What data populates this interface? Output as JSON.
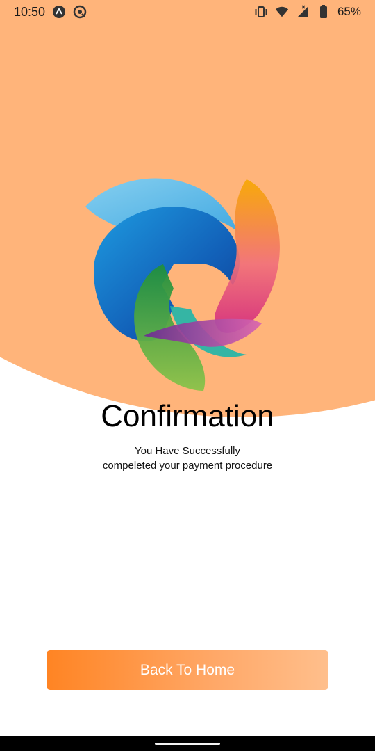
{
  "status_bar": {
    "time": "10:50",
    "battery_percent": "65%",
    "left_icons": [
      "app-notification-icon",
      "target-notification-icon"
    ],
    "right_icons": [
      "vibrate-icon",
      "wifi-icon",
      "signal-icon",
      "battery-icon"
    ]
  },
  "confirmation": {
    "title": "Confirmation",
    "message_line1": "You Have Successfully",
    "message_line2": "compeleted your payment procedure"
  },
  "actions": {
    "back_home_label": "Back To Home"
  },
  "colors": {
    "accent_bg": "#FFB47A",
    "button_start": "#FF8423",
    "button_end": "#FFBF8C"
  }
}
